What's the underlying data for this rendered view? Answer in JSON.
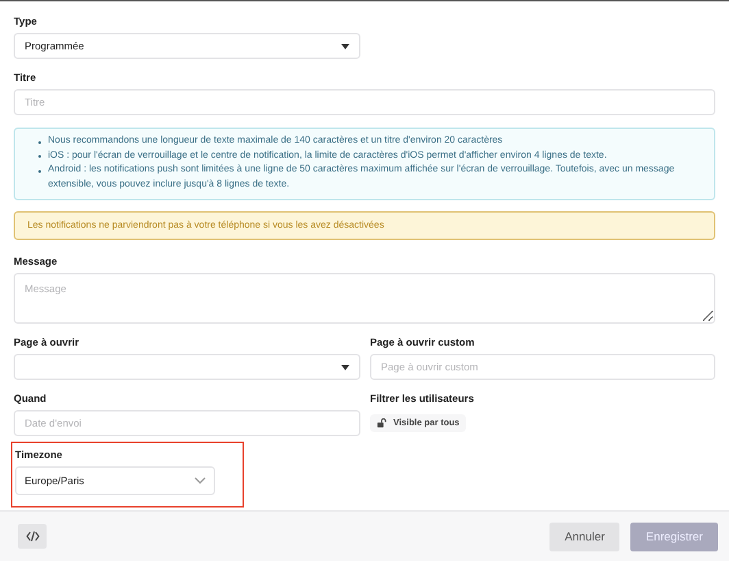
{
  "type_field": {
    "label": "Type",
    "value": "Programmée"
  },
  "title_field": {
    "label": "Titre",
    "placeholder": "Titre"
  },
  "info_notes": [
    "Nous recommandons une longueur de texte maximale de 140 caractères et un titre d'environ 20 caractères",
    "iOS : pour l'écran de verrouillage et le centre de notification, la limite de caractères d'iOS permet d'afficher environ 4 lignes de texte.",
    "Android : les notifications push sont limitées à une ligne de 50 caractères maximum affichée sur l'écran de verrouillage. Toutefois, avec un message extensible, vous pouvez inclure jusqu'à 8 lignes de texte."
  ],
  "warning": "Les notifications ne parviendront pas à votre téléphone si vous les avez désactivées",
  "message_field": {
    "label": "Message",
    "placeholder": "Message"
  },
  "page_field": {
    "label": "Page à ouvrir"
  },
  "custom_page_field": {
    "label": "Page à ouvrir custom",
    "placeholder": "Page à ouvrir custom"
  },
  "when_field": {
    "label": "Quand",
    "placeholder": "Date d'envoi"
  },
  "user_filter": {
    "label": "Filtrer les utilisateurs",
    "value": "Visible par tous"
  },
  "timezone_field": {
    "label": "Timezone",
    "value": "Europe/Paris",
    "highlighted": true
  },
  "footer": {
    "cancel": "Annuler",
    "save": "Enregistrer",
    "save_disabled": true
  }
}
